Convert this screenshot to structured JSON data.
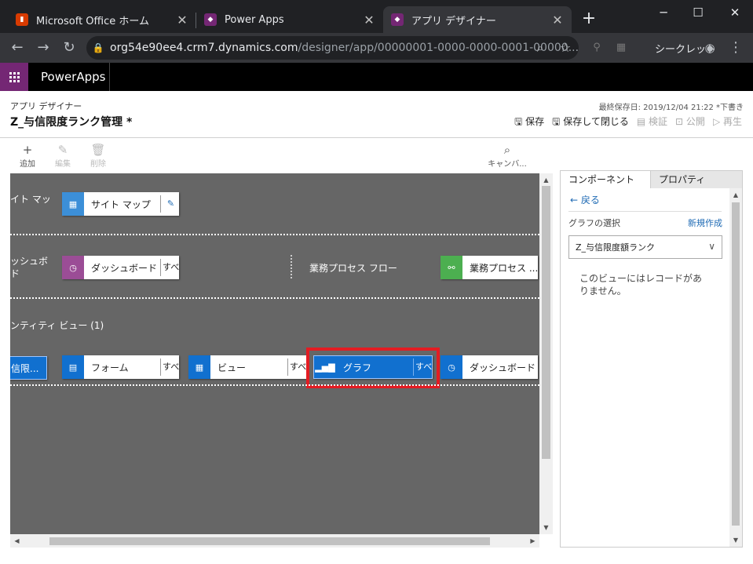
{
  "browser": {
    "tabs": [
      {
        "title": "Microsoft Office ホーム",
        "close": "✕"
      },
      {
        "title": "Power Apps",
        "close": "✕"
      },
      {
        "title": "アプリ デザイナー",
        "close": "✕"
      }
    ],
    "new_tab": "+",
    "window_controls": [
      "─",
      "☐",
      "✕"
    ],
    "url_host": "org54e90ee4.crm7.dynamics.com",
    "url_path": "/designer/app/00000001-0000-0000-0001-00000...",
    "incognito_label": "シークレット"
  },
  "powerapps": {
    "brand": "PowerApps"
  },
  "designer": {
    "breadcrumb": "アプリ デザイナー",
    "app_title": "Z_与信限度ランク管理 *",
    "last_saved": "最終保存日: 2019/12/04 21:22 *下書き",
    "actions": {
      "save": "保存",
      "save_close": "保存して閉じる",
      "validate": "検証",
      "publish": "公開",
      "play": "再生"
    },
    "commands": {
      "add": "追加",
      "edit": "編集",
      "delete": "削除",
      "canvas": "キャンバ..."
    }
  },
  "canvas": {
    "sitemap_label": "イト マッ",
    "sitemap_card": "サイト マップ",
    "dashboard_label_1": "ッシュボ",
    "dashboard_label_2": "ド",
    "dashboard_card": "ダッシュボード",
    "dashboard_sub": "すべて",
    "bpf_label": "業務プロセス フロー",
    "bpf_card": "業務プロセス ...",
    "entity_view_label": "ンティティ ビュー (1)",
    "entity_card": "信限...",
    "form_card": "フォーム",
    "form_sub": "すべて",
    "view_card": "ビュー",
    "view_sub": "すべて",
    "chart_card": "グラフ",
    "chart_sub": "すべて",
    "entity_dashboard_card": "ダッシュボード"
  },
  "panel": {
    "tab_components": "コンポーネント",
    "tab_properties": "プロパティ",
    "back": "戻る",
    "select_chart": "グラフの選択",
    "new_link": "新規作成",
    "dropdown_value": "Z_与信限度額ランク",
    "empty_message": "このビューにはレコードがありません。"
  },
  "colors": {
    "accent": "#742774",
    "selected_card": "#1170cf",
    "highlight": "#e31c23"
  }
}
